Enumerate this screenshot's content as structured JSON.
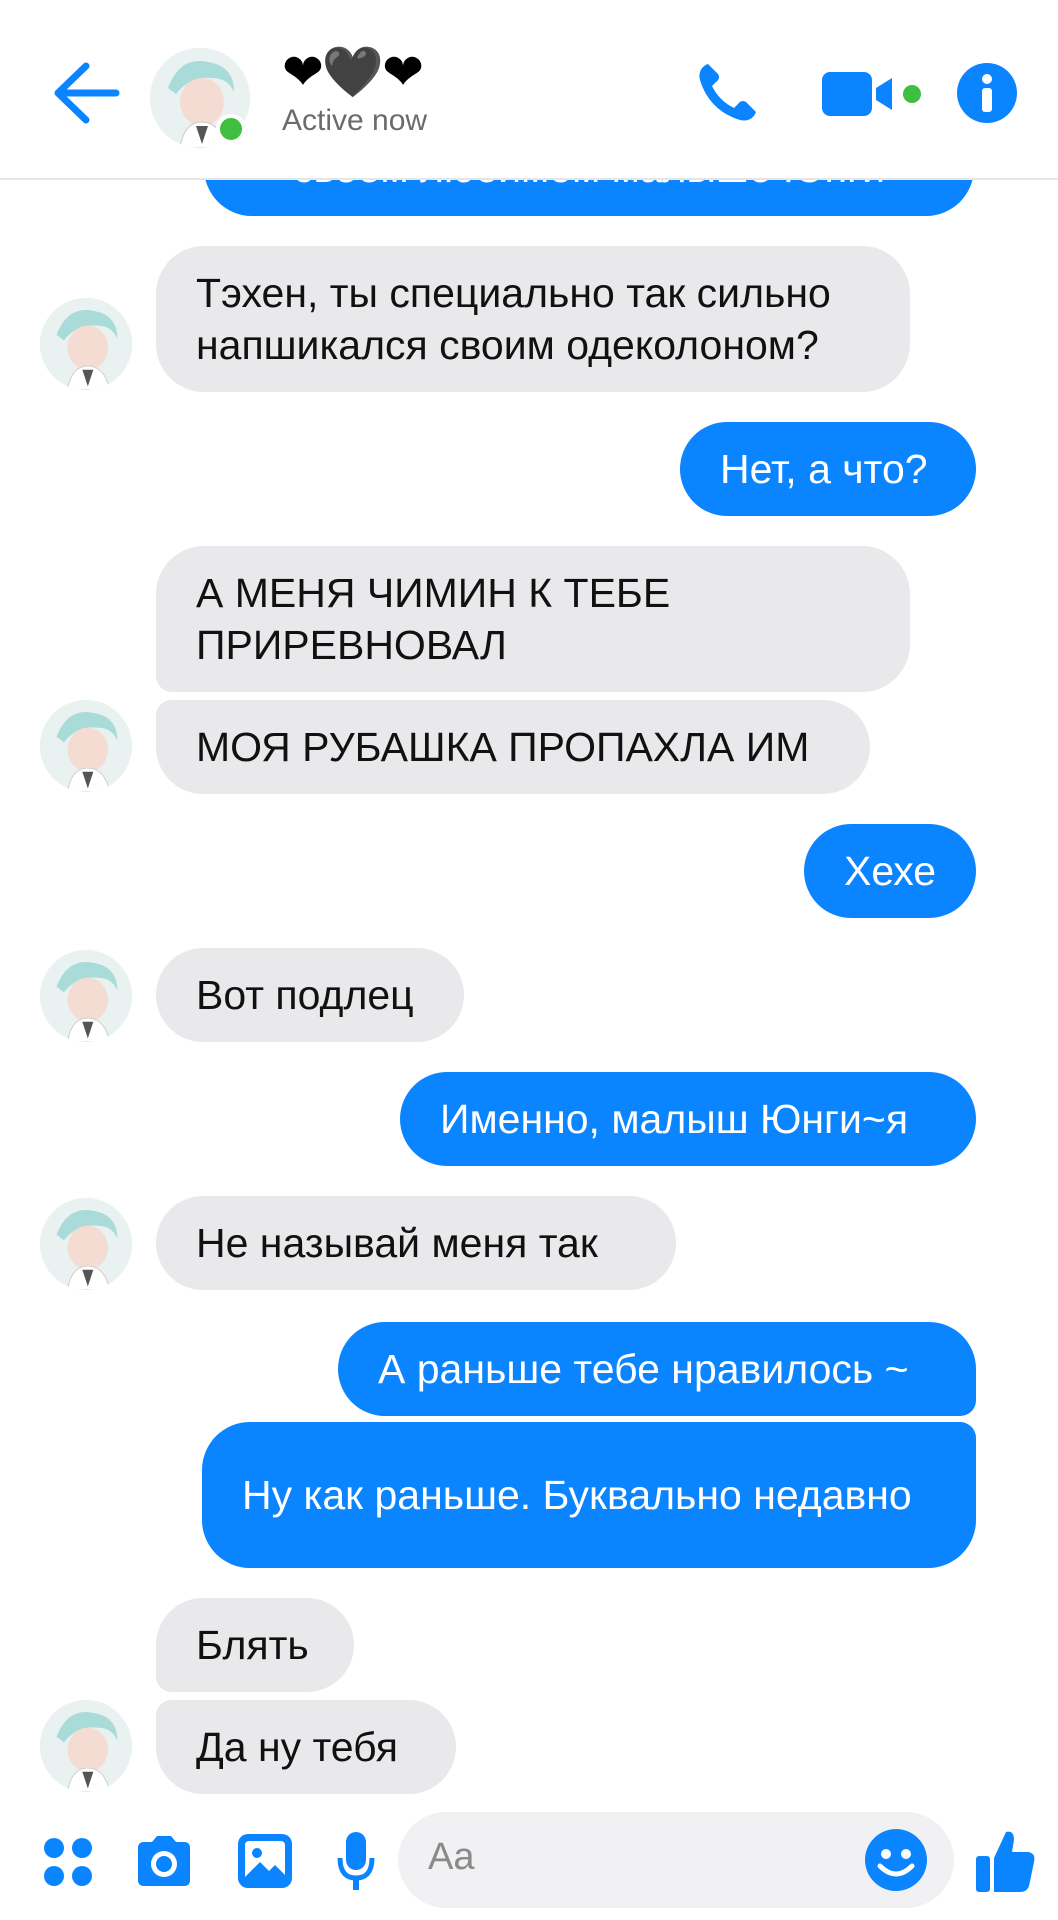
{
  "header": {
    "contact_name": "❤🖤❤",
    "status": "Active now"
  },
  "messages": [
    {
      "from": "out",
      "text": "своем любимом малыше Юнги"
    },
    {
      "from": "in",
      "text": "Тэхен, ты специально так сильно напшикался своим одеколоном?"
    },
    {
      "from": "out",
      "text": "Нет, а что?"
    },
    {
      "from": "in",
      "text": "А МЕНЯ ЧИМИН К ТЕБЕ ПРИРЕВНОВАЛ"
    },
    {
      "from": "in",
      "text": "МОЯ РУБАШКА ПРОПАХЛА ИМ"
    },
    {
      "from": "out",
      "text": "Хехе"
    },
    {
      "from": "in",
      "text": "Вот подлец"
    },
    {
      "from": "out",
      "text": "Именно, малыш Юнги~я"
    },
    {
      "from": "in",
      "text": "Не называй меня так"
    },
    {
      "from": "out",
      "text": "А раньше тебе нравилось ~"
    },
    {
      "from": "out",
      "text": "Ну как раньше. Буквально недавно"
    },
    {
      "from": "in",
      "text": "Блять"
    },
    {
      "from": "in",
      "text": "Да ну тебя"
    }
  ],
  "composer": {
    "placeholder": "Aa"
  },
  "colors": {
    "accent": "#0a84ff",
    "incoming_bubble": "#e9e9eb",
    "online": "#3fbf3f"
  },
  "icons": [
    "back-arrow-icon",
    "phone-icon",
    "video-camera-icon",
    "info-icon",
    "apps-icon",
    "camera-icon",
    "gallery-icon",
    "microphone-icon",
    "emoji-icon",
    "thumbs-up-icon"
  ]
}
